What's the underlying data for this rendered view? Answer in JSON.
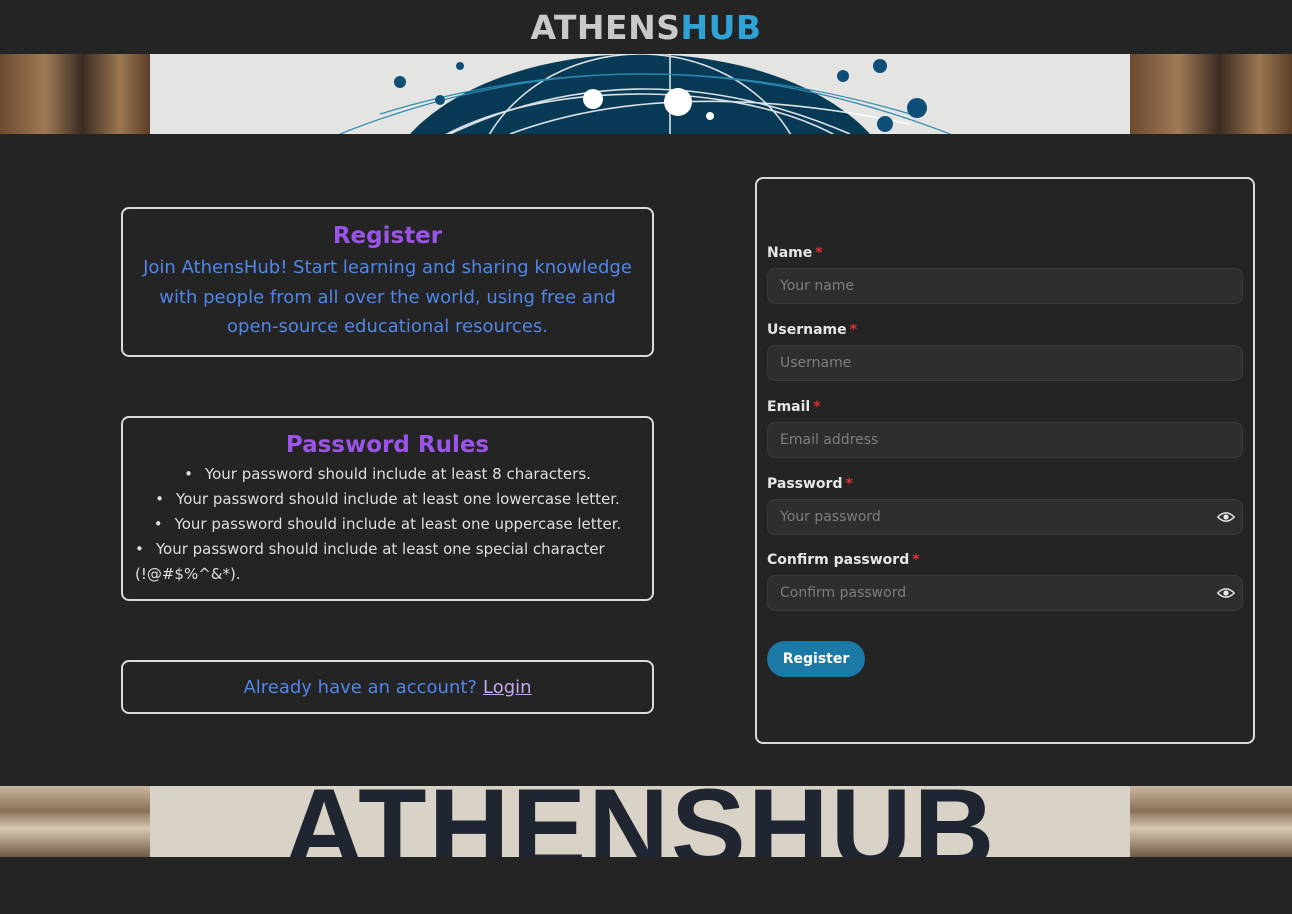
{
  "header": {
    "brand_part1": "ATHENS",
    "brand_part2": "HUB"
  },
  "background": {
    "watermark_text": "ATHENSHUB"
  },
  "intro": {
    "title": "Register",
    "text": "Join AthensHub! Start learning and sharing knowledge with people from all over the world, using free and open-source educational resources."
  },
  "rules": {
    "title": "Password Rules",
    "items": [
      "Your password should include at least 8 characters.",
      "Your password should include at least one lowercase letter.",
      "Your password should include at least one uppercase letter.",
      "Your password should include at least one special character (!@#$%^&*)."
    ]
  },
  "login": {
    "question": "Already have an account?",
    "link": "Login"
  },
  "form": {
    "required_mark": "*",
    "name": {
      "label": "Name",
      "placeholder": "Your name",
      "value": ""
    },
    "username": {
      "label": "Username",
      "placeholder": "Username",
      "value": ""
    },
    "email": {
      "label": "Email",
      "placeholder": "Email address",
      "value": ""
    },
    "password": {
      "label": "Password",
      "placeholder": "Your password",
      "value": ""
    },
    "confirm": {
      "label": "Confirm password",
      "placeholder": "Confirm password",
      "value": ""
    },
    "submit": "Register"
  },
  "icons": {
    "reveal": "eye-icon"
  },
  "colors": {
    "background": "#242424",
    "brand_gray": "#c9c9c9",
    "brand_blue": "#2fa3d6",
    "heading_purple": "#9a55e8",
    "text_blue": "#4f86e8",
    "button": "#1c7aa6",
    "required": "#e03131"
  }
}
